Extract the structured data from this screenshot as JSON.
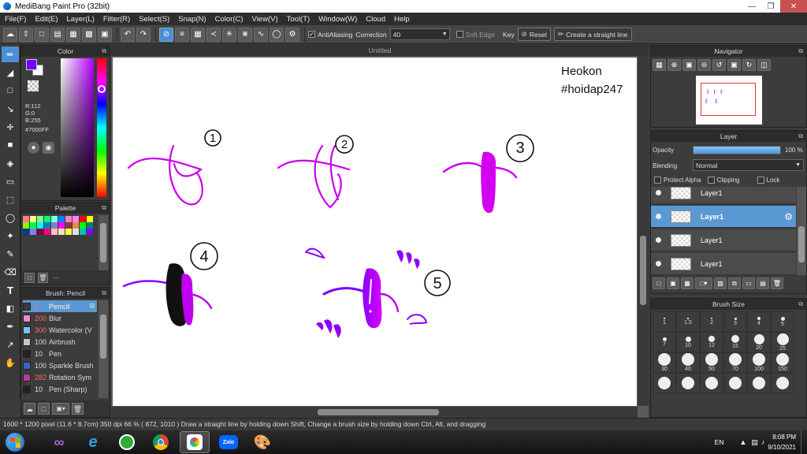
{
  "app": {
    "title": "MediBang Paint Pro (32bit)"
  },
  "menu": [
    "File(F)",
    "Edit(E)",
    "Layer(L)",
    "Filter(R)",
    "Select(S)",
    "Snap(N)",
    "Color(C)",
    "View(V)",
    "Tool(T)",
    "Window(W)",
    "Cloud",
    "Help"
  ],
  "toolbar": {
    "antialias_label": "AntiAliasing",
    "correction_label": "Correction",
    "correction_value": "40",
    "soft_edge_label": "Soft Edge",
    "key_label": "Key",
    "reset_label": "Reset",
    "straight_line_label": "Create a straight line"
  },
  "color_panel": {
    "title": "Color",
    "r": "R:112",
    "g": "G:0",
    "b": "B:255",
    "hex": "#7000FF",
    "foreground": "#7000FF",
    "hue_marker_fraction": 0.22
  },
  "palette_panel": {
    "title": "Palette",
    "footer": "---",
    "swatches": [
      "#ff8080",
      "#ffff80",
      "#80ff80",
      "#00ff80",
      "#80ffff",
      "#0080ff",
      "#ff80c0",
      "#ff80ff",
      "#ff0000",
      "#ffff00",
      "#80ff00",
      "#00ff40",
      "#00ffff",
      "#0080c0",
      "#8080c0",
      "#ff00ff",
      "#804040",
      "#ff8040",
      "#00ff00",
      "#008080",
      "#004080",
      "#8080ff",
      "#800040",
      "#ff0080",
      "#ffc0c0",
      "#ffe0c0",
      "#ffff40",
      "#e0e0e0",
      "#00c0c0",
      "#8000ff"
    ]
  },
  "brush_panel": {
    "title": "Brush: Pencil",
    "items": [
      {
        "size": "4",
        "name": "Pencil",
        "color": "#3a3a3a"
      },
      {
        "size": "200",
        "name": "Blur",
        "color": "#f08cc8"
      },
      {
        "size": "300",
        "name": "Watercolor (V",
        "color": "#6ec8f0"
      },
      {
        "size": "100",
        "name": "Airbrush",
        "color": "#c8c8c8"
      },
      {
        "size": "10",
        "name": "Pen",
        "color": "#222222"
      },
      {
        "size": "100",
        "name": "Sparkle Brush",
        "color": "#3c64c8"
      },
      {
        "size": "282",
        "name": "Rotation Sym",
        "color": "#b43ca0"
      },
      {
        "size": "10",
        "name": "Pen (Sharp)",
        "color": "#222222"
      }
    ]
  },
  "document": {
    "tab": "Untitled",
    "text_line1": "Heokon",
    "text_line2": "#hoidap247",
    "labels": [
      "1",
      "2",
      "3",
      "4",
      "5"
    ]
  },
  "navigator": {
    "title": "Navigator"
  },
  "layer_panel": {
    "title": "Layer",
    "opacity_label": "Opacity",
    "opacity_value": "100 %",
    "opacity_fraction": 1.0,
    "blending_label": "Blending",
    "blending_value": "Normal",
    "protect_alpha": "Protect Alpha",
    "clipping": "Clipping",
    "lock": "Lock",
    "layers": [
      "Layer1",
      "Layer1",
      "Layer1",
      "Layer1"
    ],
    "selected_index": 1
  },
  "brush_size_panel": {
    "title": "Brush Size",
    "sizes": [
      "1",
      "1.5",
      "2",
      "3",
      "4",
      "5",
      "7",
      "10",
      "12",
      "15",
      "20",
      "25",
      "30",
      "40",
      "50",
      "70",
      "100",
      "150"
    ]
  },
  "status": {
    "text": "1600 * 1200 pixel  (11.6 * 8.7cm)  350 dpi  66 %  ( 872, 1010 )  Draw a straight line by holding down Shift, Change a brush size by holding down Ctrl, Alt, and dragging"
  },
  "taskbar": {
    "lang": "EN",
    "time": "8:08 PM",
    "date": "9/10/2021",
    "zalo_label": "Zalo"
  }
}
